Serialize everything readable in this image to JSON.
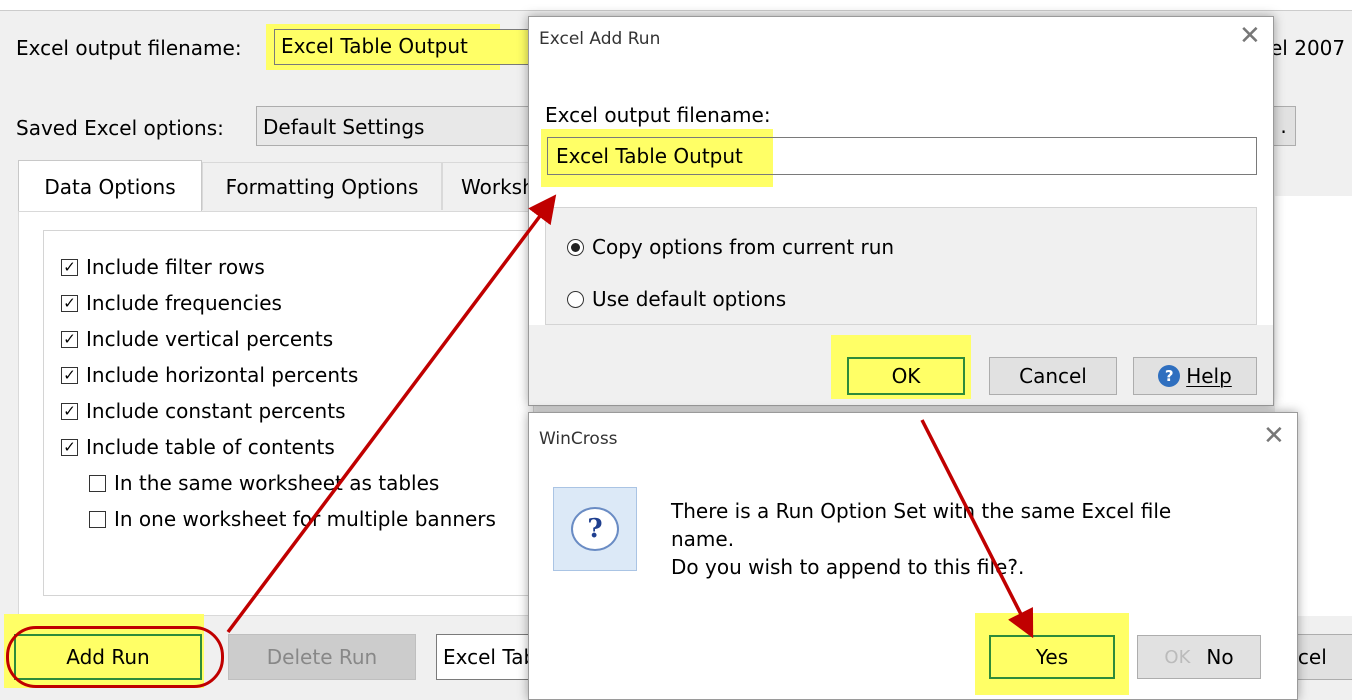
{
  "main": {
    "filename_label": "Excel output filename:",
    "filename_value": "Excel Table Output",
    "right_partial": "el 2007",
    "saved_label": "Saved Excel options:",
    "saved_value": "Default Settings",
    "saved_btn_partial": ".",
    "tabs": [
      {
        "label": "Data Options"
      },
      {
        "label": "Formatting Options"
      },
      {
        "label": "Worksh"
      }
    ],
    "checks": [
      {
        "label": "Include filter rows",
        "checked": true
      },
      {
        "label": "Include frequencies",
        "checked": true
      },
      {
        "label": "Include vertical percents",
        "checked": true
      },
      {
        "label": "Include horizontal percents",
        "checked": true
      },
      {
        "label": "Include constant percents",
        "checked": true
      },
      {
        "label": "Include table of contents",
        "checked": true
      },
      {
        "label": "In the same worksheet as tables",
        "checked": false
      },
      {
        "label": "In one worksheet for multiple banners",
        "checked": false
      }
    ],
    "add_run": "Add Run",
    "delete_run": "Delete Run",
    "run_select": "Excel Table Output.xlsx",
    "cancel_partial": "ancel"
  },
  "add_run_dialog": {
    "title": "Excel Add Run",
    "label": "Excel output filename:",
    "value": "Excel Table Output",
    "radio_copy": "Copy options from current run",
    "radio_default": "Use default options",
    "selected": "copy",
    "ok": "OK",
    "cancel": "Cancel",
    "help": "Help"
  },
  "wincross_dialog": {
    "title": "WinCross",
    "line1": "There is a Run Option Set with the same Excel file",
    "line2": "name.",
    "line3": "Do you wish to append to this file?.",
    "yes": "Yes",
    "no": "No",
    "ok_partial": "OK"
  },
  "colors": {
    "highlight": "#ffff66",
    "arrow": "#c00000",
    "green_border": "#2e8b3a"
  },
  "icons": {
    "check": "check-icon",
    "help": "help-icon",
    "question": "question-bubble-icon",
    "close": "close-icon"
  }
}
